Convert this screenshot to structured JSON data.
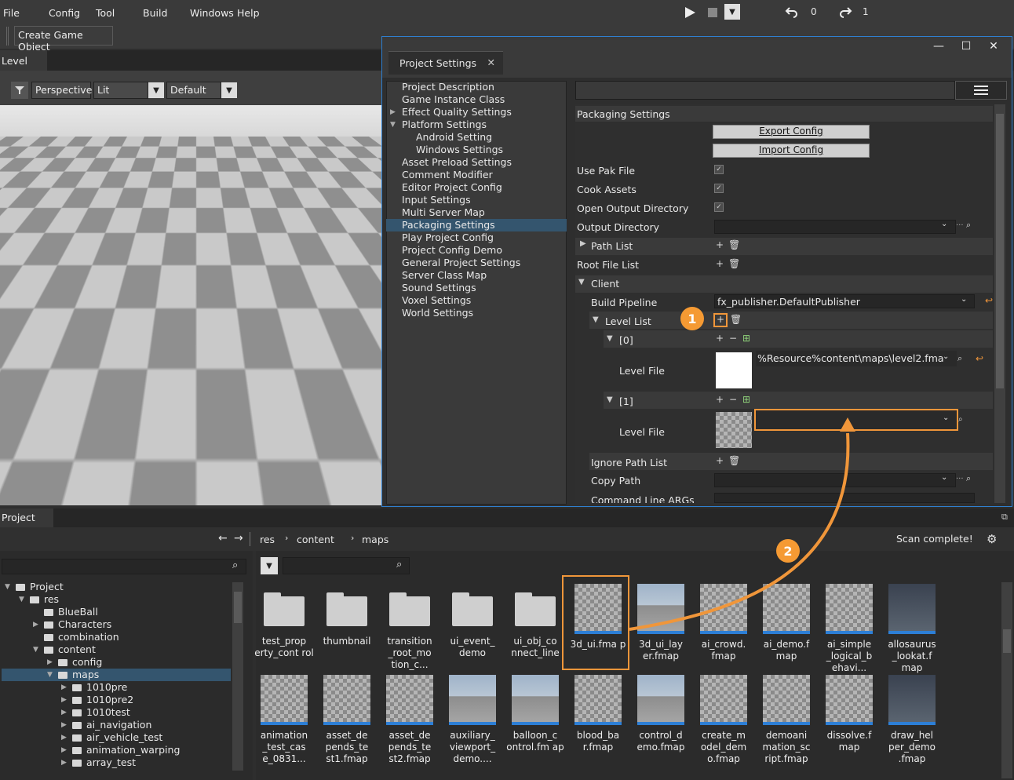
{
  "menubar": {
    "items": [
      "File",
      "Config",
      "Tool",
      "Build",
      "Windows",
      "Help"
    ],
    "undo_count": "0",
    "redo_count": "1"
  },
  "toolbar": {
    "create_game_object": "Create Game Object"
  },
  "level_tab": "Level",
  "viewport": {
    "camera": "Perspective",
    "shading": "Lit",
    "preset": "Default"
  },
  "project_settings": {
    "tab_title": "Project Settings",
    "nav": [
      {
        "label": "Project Description",
        "level": 0,
        "arrow": ""
      },
      {
        "label": "Game Instance Class",
        "level": 0,
        "arrow": ""
      },
      {
        "label": "Effect Quality Settings",
        "level": 0,
        "arrow": "right"
      },
      {
        "label": "Platform Settings",
        "level": 0,
        "arrow": "down"
      },
      {
        "label": "Android Setting",
        "level": 1,
        "arrow": ""
      },
      {
        "label": "Windows Settings",
        "level": 1,
        "arrow": ""
      },
      {
        "label": "Asset Preload Settings",
        "level": 0,
        "arrow": ""
      },
      {
        "label": "Comment Modifier",
        "level": 0,
        "arrow": ""
      },
      {
        "label": "Editor Project Config",
        "level": 0,
        "arrow": ""
      },
      {
        "label": "Input Settings",
        "level": 0,
        "arrow": ""
      },
      {
        "label": "Multi Server Map",
        "level": 0,
        "arrow": ""
      },
      {
        "label": "Packaging Settings",
        "level": 0,
        "arrow": "",
        "selected": true
      },
      {
        "label": "Play Project Config",
        "level": 0,
        "arrow": ""
      },
      {
        "label": "Project Config Demo",
        "level": 0,
        "arrow": ""
      },
      {
        "label": "General Project Settings",
        "level": 0,
        "arrow": ""
      },
      {
        "label": "Server Class Map",
        "level": 0,
        "arrow": ""
      },
      {
        "label": "Sound Settings",
        "level": 0,
        "arrow": ""
      },
      {
        "label": "Voxel Settings",
        "level": 0,
        "arrow": ""
      },
      {
        "label": "World Settings",
        "level": 0,
        "arrow": ""
      }
    ],
    "section_title": "Packaging Settings",
    "export_config": "Export Config",
    "import_config": "Import Config",
    "use_pak_file": "Use Pak File",
    "cook_assets": "Cook Assets",
    "open_output_directory": "Open Output Directory",
    "output_directory": "Output Directory",
    "path_list": "Path List",
    "root_file_list": "Root File List",
    "client": "Client",
    "build_pipeline": "Build Pipeline",
    "build_pipeline_value": "fx_publisher.DefaultPublisher",
    "level_list": "Level List",
    "item0": "[0]",
    "item1": "[1]",
    "level_file": "Level File",
    "level_file_0_value": "%Resource%content\\maps\\level2.fma",
    "ignore_path_list": "Ignore Path List",
    "copy_path": "Copy Path",
    "command_line_args": "Command Line ARGs",
    "badge1": "1",
    "badge2": "2"
  },
  "project_panel": {
    "tab": "Project",
    "breadcrumb": [
      "res",
      "content",
      "maps"
    ],
    "status": "Scan complete!",
    "tree": [
      {
        "label": "Project",
        "depth": 0,
        "arrow": "down",
        "open": true
      },
      {
        "label": "res",
        "depth": 1,
        "arrow": "down",
        "open": true
      },
      {
        "label": "BlueBall",
        "depth": 2,
        "arrow": ""
      },
      {
        "label": "Characters",
        "depth": 2,
        "arrow": "right"
      },
      {
        "label": "combination",
        "depth": 2,
        "arrow": ""
      },
      {
        "label": "content",
        "depth": 2,
        "arrow": "down",
        "open": true
      },
      {
        "label": "config",
        "depth": 3,
        "arrow": "right"
      },
      {
        "label": "maps",
        "depth": 3,
        "arrow": "down",
        "open": true,
        "selected": true
      },
      {
        "label": "1010pre",
        "depth": 4,
        "arrow": "right"
      },
      {
        "label": "1010pre2",
        "depth": 4,
        "arrow": "right"
      },
      {
        "label": "1010test",
        "depth": 4,
        "arrow": "right"
      },
      {
        "label": "ai_navigation",
        "depth": 4,
        "arrow": "right"
      },
      {
        "label": "air_vehicle_test",
        "depth": 4,
        "arrow": "right"
      },
      {
        "label": "animation_warping",
        "depth": 4,
        "arrow": "right"
      },
      {
        "label": "array_test",
        "depth": 4,
        "arrow": "right"
      }
    ],
    "assets_row1": [
      {
        "label": "test_prop erty_cont rol",
        "kind": "folder"
      },
      {
        "label": "thumbnail",
        "kind": "folder"
      },
      {
        "label": "transition _root_mo tion_c...",
        "kind": "folder"
      },
      {
        "label": "ui_event_ demo",
        "kind": "folder"
      },
      {
        "label": "ui_obj_co nnect_line",
        "kind": "folder"
      },
      {
        "label": "3d_ui.fma p",
        "kind": "checker",
        "highlight": true
      },
      {
        "label": "3d_ui_lay er.fmap",
        "kind": "sky"
      },
      {
        "label": "ai_crowd. fmap",
        "kind": "checker"
      },
      {
        "label": "ai_demo.f map",
        "kind": "checker"
      },
      {
        "label": "ai_simple _logical_b ehavi...",
        "kind": "checker"
      },
      {
        "label": "allosaurus _lookat.f map",
        "kind": "dark"
      }
    ],
    "assets_row2": [
      {
        "label": "animation _test_cas e_0831...",
        "kind": "checker"
      },
      {
        "label": "asset_de pends_te st1.fmap",
        "kind": "checker"
      },
      {
        "label": "asset_de pends_te st2.fmap",
        "kind": "checker"
      },
      {
        "label": "auxiliary_ viewport_ demo....",
        "kind": "sky"
      },
      {
        "label": "balloon_c ontrol.fm ap",
        "kind": "sky"
      },
      {
        "label": "blood_ba r.fmap",
        "kind": "checker"
      },
      {
        "label": "control_d emo.fmap",
        "kind": "sky"
      },
      {
        "label": "create_m odel_dem o.fmap",
        "kind": "checker"
      },
      {
        "label": "demoani mation_sc ript.fmap",
        "kind": "checker"
      },
      {
        "label": "dissolve.f map",
        "kind": "checker"
      },
      {
        "label": "draw_hel per_demo .fmap",
        "kind": "dark"
      }
    ]
  },
  "colors": {
    "accent": "#f0963a",
    "selection": "#34556e",
    "window_border": "#2f7fcf"
  }
}
